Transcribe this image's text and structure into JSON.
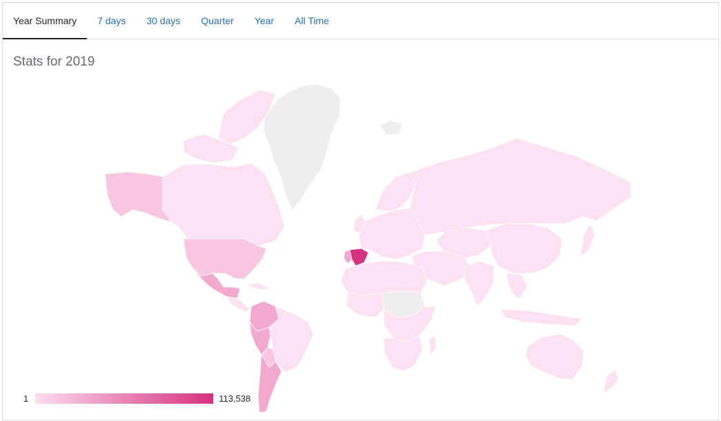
{
  "tabs": [
    {
      "label": "Year Summary",
      "active": true
    },
    {
      "label": "7 days",
      "active": false
    },
    {
      "label": "30 days",
      "active": false
    },
    {
      "label": "Quarter",
      "active": false
    },
    {
      "label": "Year",
      "active": false
    },
    {
      "label": "All Time",
      "active": false
    }
  ],
  "title": "Stats for 2019",
  "legend": {
    "min_label": "1",
    "max_label": "113,538",
    "min_color": "#fcdcee",
    "max_color": "#d6307f"
  },
  "colors": {
    "no_data": "#eeeeee",
    "low": "#fde0f1",
    "mid_low": "#f9c6e1",
    "mid": "#f3a8ce",
    "high": "#d6307f",
    "border": "#ffffff"
  },
  "regions": [
    {
      "name": "Spain",
      "level": "high"
    },
    {
      "name": "Mexico",
      "level": "mid"
    },
    {
      "name": "Colombia",
      "level": "mid"
    },
    {
      "name": "Argentina",
      "level": "mid"
    },
    {
      "name": "Peru",
      "level": "mid"
    },
    {
      "name": "United States",
      "level": "mid_low"
    },
    {
      "name": "Alaska",
      "level": "mid_low"
    },
    {
      "name": "Greenland",
      "level": "no_data"
    }
  ]
}
